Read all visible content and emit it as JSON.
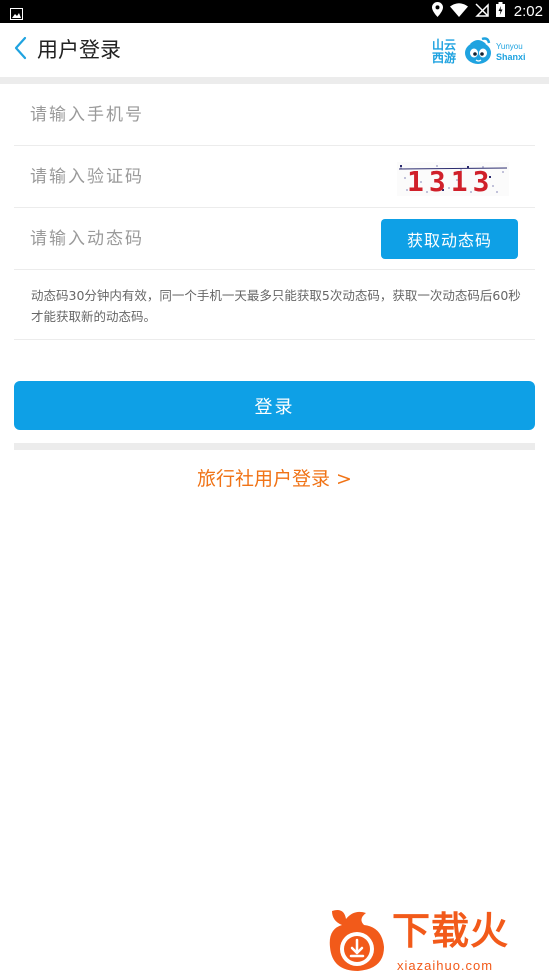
{
  "status_bar": {
    "time": "2:02",
    "icons": [
      "image-icon",
      "location-icon",
      "wifi-icon",
      "no-sim-icon",
      "battery-icon"
    ]
  },
  "header": {
    "title": "用户登录",
    "back_icon": "chevron-left-icon",
    "logo": {
      "cn_line1": "山云",
      "cn_line2": "西游",
      "en_line1": "Yunyou",
      "en_line2": "Shanxi"
    }
  },
  "form": {
    "phone_placeholder": "请输入手机号",
    "captcha_placeholder": "请输入验证码",
    "captcha_text": "1313",
    "dynamic_code_placeholder": "请输入动态码",
    "get_code_label": "获取动态码",
    "notice": "动态码30分钟内有效，同一个手机一天最多只能获取5次动态码，获取一次动态码后60秒才能获取新的动态码。"
  },
  "login_label": "登录",
  "agency_login_label": "旅行社用户登录 >",
  "watermark": {
    "text": "下载火",
    "sub": "xiazaihuo.com"
  },
  "colors": {
    "primary": "#0ea0e6",
    "link": "#f07316",
    "watermark": "#f25a1a",
    "divider": "#ececec"
  }
}
